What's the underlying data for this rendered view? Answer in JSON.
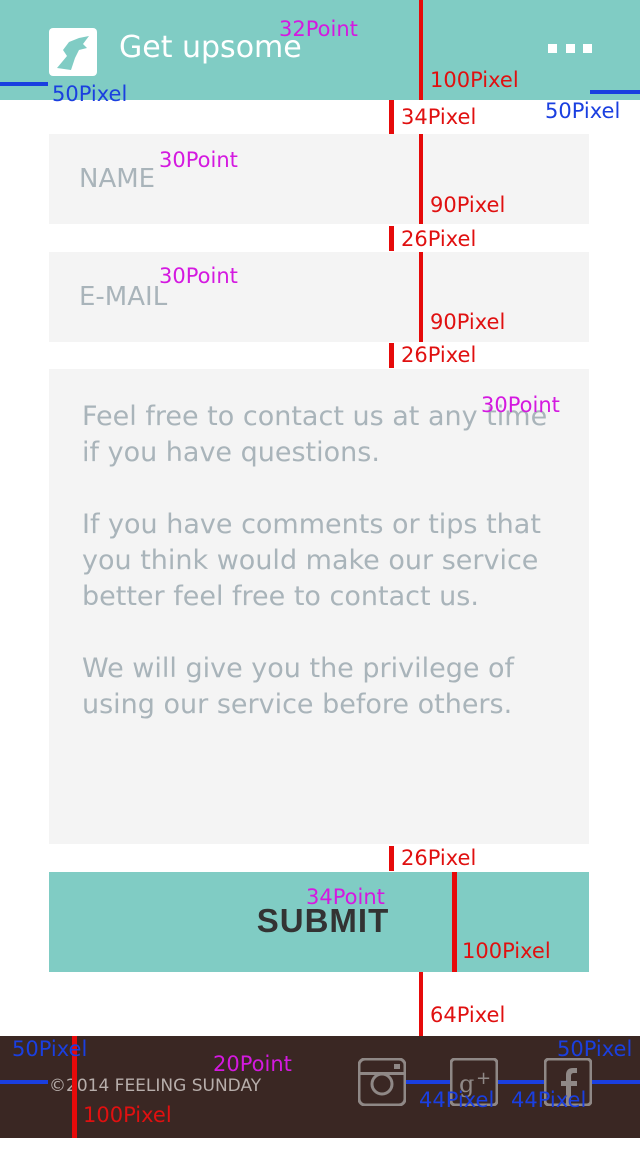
{
  "header": {
    "title": "Get upsome",
    "logo_icon": "bird-logo-icon",
    "menu_icon": "more-dots-icon",
    "background": "#80ccc4"
  },
  "form": {
    "name_placeholder": "NAME",
    "email_placeholder": "E-MAIL",
    "message_paragraphs": [
      "Feel free to contact us at any time if you have questions.",
      "If you have comments or tips that you think would make our service better feel free to contact us.",
      "We will give you the privilege of using our service before others."
    ],
    "submit_label": "SUBMIT"
  },
  "footer": {
    "copyright": "©2014 FEELING SUNDAY",
    "icons": [
      "instagram-icon",
      "google-plus-icon",
      "facebook-icon"
    ],
    "background": "#3a2723"
  },
  "annotations": {
    "header_title_size": "32Point",
    "header_height": "100Pixel",
    "left_margin": "50Pixel",
    "right_margin": "50Pixel",
    "gap_top": "34Pixel",
    "name_size": "30Point",
    "name_height": "90Pixel",
    "gap_1": "26Pixel",
    "email_size": "30Point",
    "email_height": "90Pixel",
    "gap_2": "26Pixel",
    "message_size": "30Point",
    "gap_3": "26Pixel",
    "submit_size": "34Point",
    "submit_height": "100Pixel",
    "gap_bottom": "64Pixel",
    "footer_left_margin": "50Pixel",
    "footer_text_size": "20Point",
    "footer_right_margin": "50Pixel",
    "icon_gap_1": "44Pixel",
    "icon_gap_2": "44Pixel",
    "footer_height": "100Pixel"
  }
}
